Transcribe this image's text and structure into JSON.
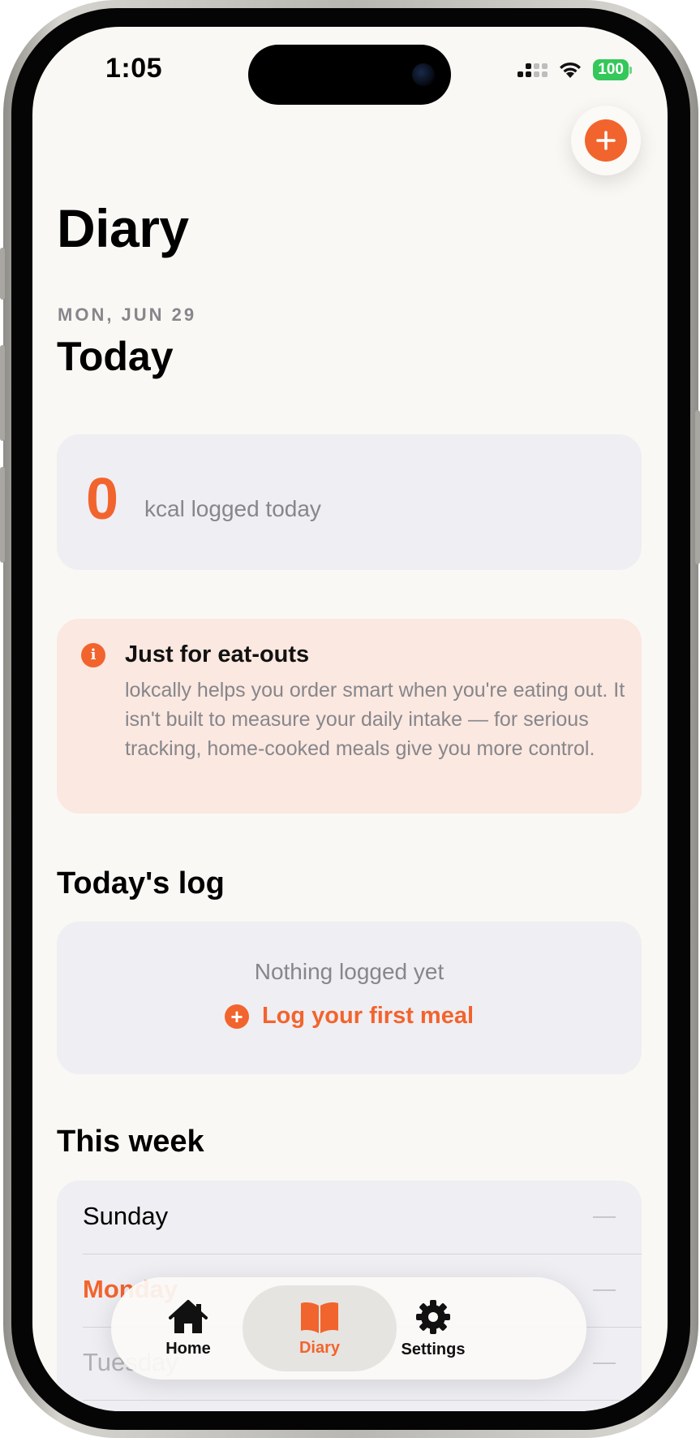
{
  "status": {
    "time": "1:05",
    "battery": "100"
  },
  "header": {
    "title": "Diary"
  },
  "date": {
    "caption": "MON, JUN 29",
    "heading": "Today"
  },
  "summary": {
    "kcal_value": "0",
    "kcal_label": "kcal logged today"
  },
  "notice": {
    "icon": "info-icon",
    "icon_glyph": "i",
    "title": "Just for eat-outs",
    "body": "lokcally helps you order smart when you're eating out. It isn't built to measure your daily intake — for serious tracking, home-cooked meals give you more control."
  },
  "todays_log": {
    "heading": "Today's log",
    "empty_text": "Nothing logged yet",
    "action_label": "Log your first meal"
  },
  "this_week": {
    "heading": "This week",
    "days": [
      {
        "name": "Sunday",
        "value": "—"
      },
      {
        "name": "Monday",
        "value": "—",
        "highlight": true
      },
      {
        "name": "Tuesday",
        "value": "—"
      }
    ]
  },
  "tabbar": {
    "tabs": [
      {
        "label": "Home",
        "icon": "house-icon"
      },
      {
        "label": "Diary",
        "icon": "book-icon",
        "active": true
      },
      {
        "label": "Settings",
        "icon": "gear-icon"
      }
    ]
  },
  "colors": {
    "accent": "#f2642d",
    "card": "#efeef3",
    "notice_bg": "#fbe8e0",
    "background": "#f9f8f4"
  }
}
